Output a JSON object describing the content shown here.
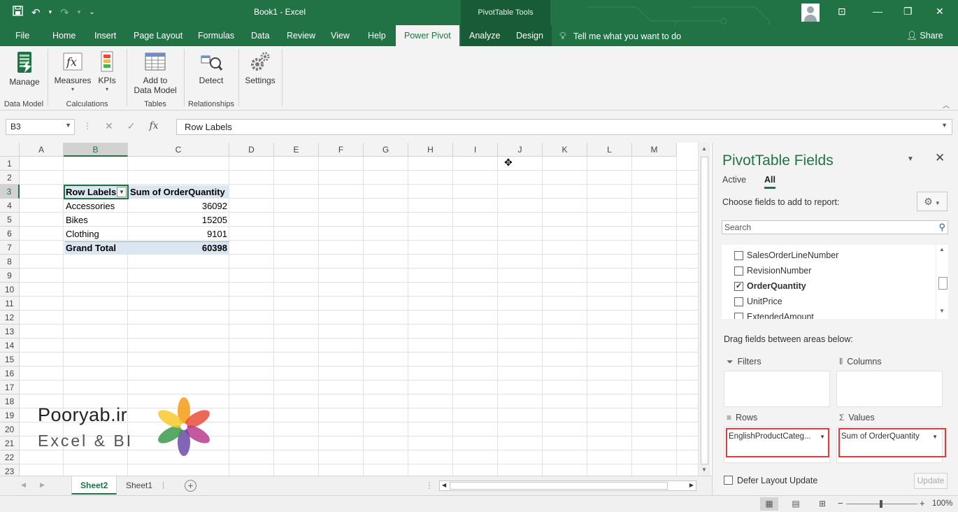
{
  "window": {
    "title": "Book1  -  Excel",
    "context_title": "PivotTable Tools",
    "qat": {
      "save_icon": "save-icon",
      "undo_icon": "undo-icon",
      "redo_icon": "redo-icon",
      "customize_icon": "customize-qat-icon"
    },
    "controls": {
      "ribbon_display": "⊡",
      "minimize": "—",
      "restore": "❐",
      "close": "✕"
    }
  },
  "tabs": [
    "File",
    "Home",
    "Insert",
    "Page Layout",
    "Formulas",
    "Data",
    "Review",
    "View",
    "Help",
    "Power Pivot",
    "Analyze",
    "Design"
  ],
  "active_tab": "Power Pivot",
  "tell_me": "Tell me what you want to do",
  "share": "Share",
  "ribbon": {
    "manage": "Manage",
    "measures": "Measures",
    "kpis": "KPIs",
    "add_to": "Add to",
    "data_model": "Data Model",
    "detect": "Detect",
    "settings": "Settings",
    "groups": {
      "data_model": "Data Model",
      "calculations": "Calculations",
      "tables": "Tables",
      "relationships": "Relationships"
    }
  },
  "formula_bar": {
    "name_box": "B3",
    "cancel": "✕",
    "enter": "✓",
    "fx": "fx",
    "formula": "Row Labels"
  },
  "columns": [
    "A",
    "B",
    "C",
    "D",
    "E",
    "F",
    "G",
    "H",
    "I",
    "J",
    "K",
    "L",
    "M"
  ],
  "rows": [
    "1",
    "2",
    "3",
    "4",
    "5",
    "6",
    "7",
    "8",
    "9",
    "10",
    "11",
    "12",
    "13",
    "14",
    "15",
    "16",
    "17",
    "18",
    "19",
    "20",
    "21",
    "22",
    "23"
  ],
  "pivot": {
    "header_rows": "Row Labels",
    "header_values": "Sum of OrderQuantity",
    "items": [
      {
        "label": "Accessories",
        "value": "36092"
      },
      {
        "label": "Bikes",
        "value": "15205"
      },
      {
        "label": "Clothing",
        "value": "9101"
      }
    ],
    "total_label": "Grand Total",
    "total_value": "60398"
  },
  "watermark": {
    "title": "Pooryab.ir",
    "subtitle": "Excel & BI"
  },
  "sheets": [
    "Sheet2",
    "Sheet1"
  ],
  "active_sheet": "Sheet2",
  "status": {
    "zoom": "100%",
    "zoom_out": "−",
    "zoom_in": "+"
  },
  "pane": {
    "title": "PivotTable Fields",
    "tab_active": "Active",
    "tab_all": "All",
    "choose": "Choose fields to add to report:",
    "search_placeholder": "Search",
    "fields": [
      {
        "name": "SalesOrderLineNumber",
        "checked": false
      },
      {
        "name": "RevisionNumber",
        "checked": false
      },
      {
        "name": "OrderQuantity",
        "checked": true
      },
      {
        "name": "UnitPrice",
        "checked": false
      },
      {
        "name": "ExtendedAmount",
        "checked": false
      }
    ],
    "drag_text": "Drag fields between areas below:",
    "areas": {
      "filters": "Filters",
      "columns": "Columns",
      "rows": "Rows",
      "values": "Values",
      "rows_item": "EnglishProductCateg...",
      "values_item": "Sum of OrderQuantity"
    },
    "defer": "Defer Layout Update",
    "update": "Update"
  },
  "colors": {
    "brand": "#217346",
    "dark_brand": "#185c37",
    "pivot_band": "#dce6f1",
    "highlight": "#e0393e"
  }
}
